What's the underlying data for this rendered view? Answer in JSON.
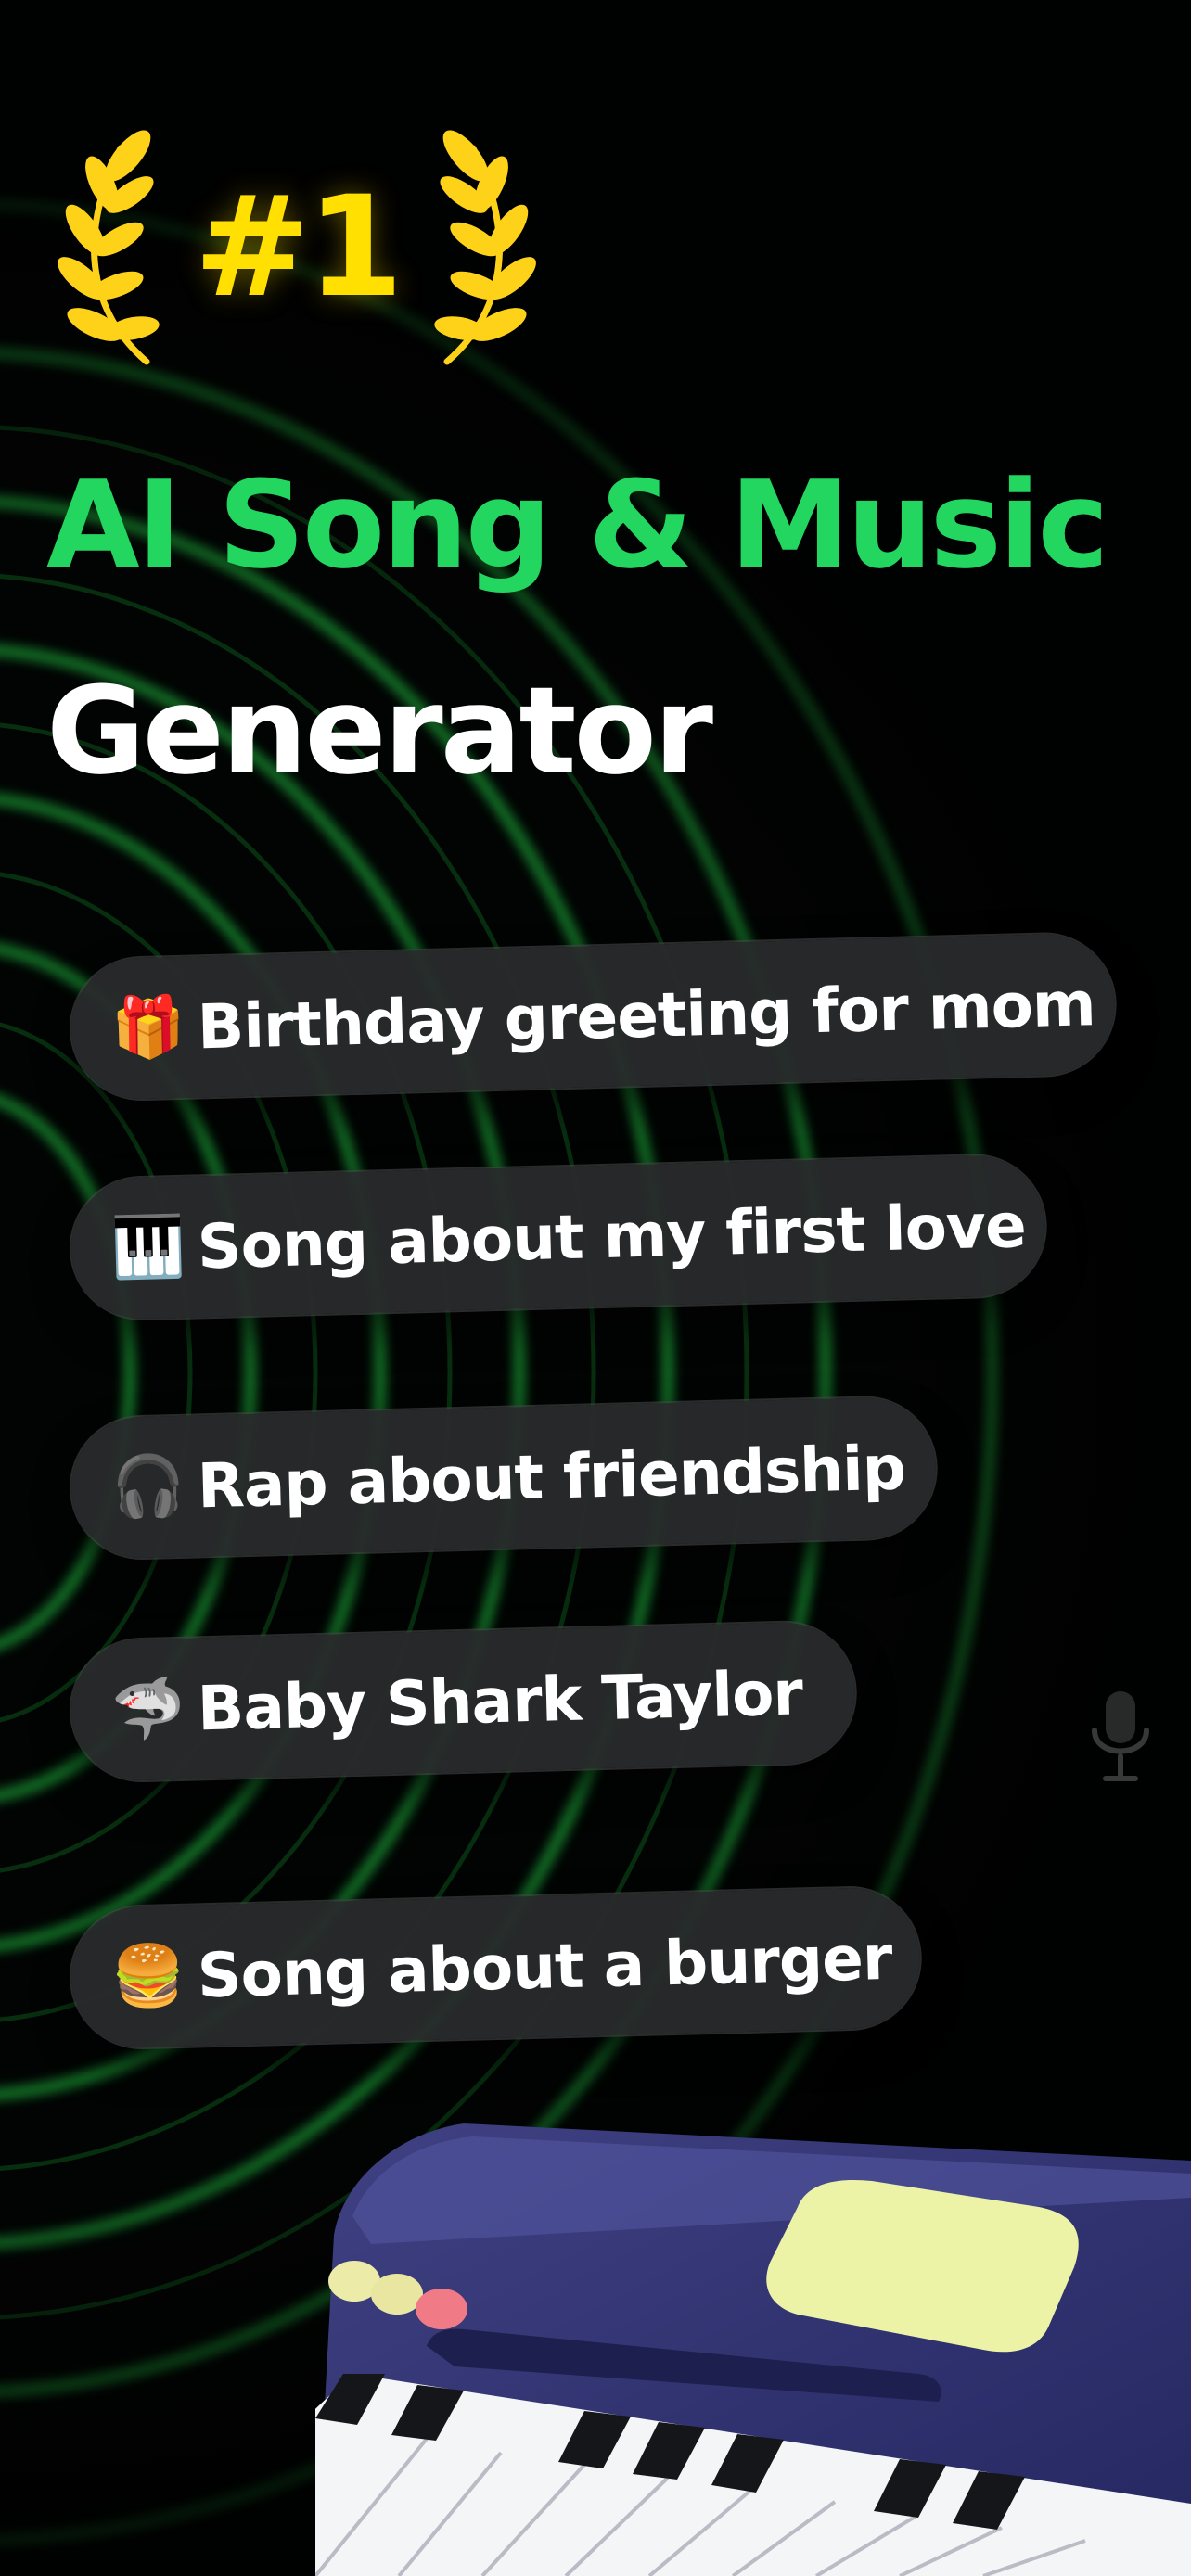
{
  "badge": {
    "rank": "#1",
    "left_icon": "laurel-left-icon",
    "right_icon": "laurel-right-icon"
  },
  "headline": {
    "line1": "AI Song & Music",
    "line2": "Generator"
  },
  "prompts": [
    {
      "icon": "gift-icon",
      "emoji": "🎁",
      "text": "Birthday greeting for mom"
    },
    {
      "icon": "piano-keys-icon",
      "emoji": "🎹",
      "text": "Song about my first love"
    },
    {
      "icon": "headphones-icon",
      "emoji": "🎧",
      "text": "Rap about friendship"
    },
    {
      "icon": "shark-icon",
      "emoji": "🦈",
      "text": "Baby Shark  Taylor"
    },
    {
      "icon": "burger-icon",
      "emoji": "🍔",
      "text": "Song about a burger"
    }
  ],
  "decor": {
    "mic_icon": "microphone-icon",
    "keyboard": "synth-keyboard-illustration"
  },
  "colors": {
    "accent_green": "#22D65F",
    "rank_yellow": "#FFE000",
    "background": "#000000",
    "pill": "#28292B"
  }
}
